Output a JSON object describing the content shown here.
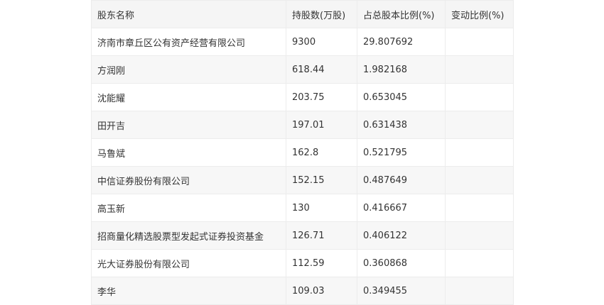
{
  "table": {
    "headers": [
      "股东名称",
      "持股数(万股)",
      "占总股本比例(%)",
      "变动比例(%)"
    ],
    "rows": [
      {
        "name": "济南市章丘区公有资产经营有限公司",
        "shares": "9300",
        "ratio": "29.807692",
        "change": ""
      },
      {
        "name": "方润刚",
        "shares": "618.44",
        "ratio": "1.982168",
        "change": ""
      },
      {
        "name": "沈能耀",
        "shares": "203.75",
        "ratio": "0.653045",
        "change": ""
      },
      {
        "name": "田开吉",
        "shares": "197.01",
        "ratio": "0.631438",
        "change": ""
      },
      {
        "name": "马鲁斌",
        "shares": "162.8",
        "ratio": "0.521795",
        "change": ""
      },
      {
        "name": "中信证券股份有限公司",
        "shares": "152.15",
        "ratio": "0.487649",
        "change": ""
      },
      {
        "name": "高玉新",
        "shares": "130",
        "ratio": "0.416667",
        "change": ""
      },
      {
        "name": "招商量化精选股票型发起式证券投资基金",
        "shares": "126.71",
        "ratio": "0.406122",
        "change": ""
      },
      {
        "name": "光大证券股份有限公司",
        "shares": "112.59",
        "ratio": "0.360868",
        "change": ""
      },
      {
        "name": "李华",
        "shares": "109.03",
        "ratio": "0.349455",
        "change": ""
      }
    ]
  }
}
